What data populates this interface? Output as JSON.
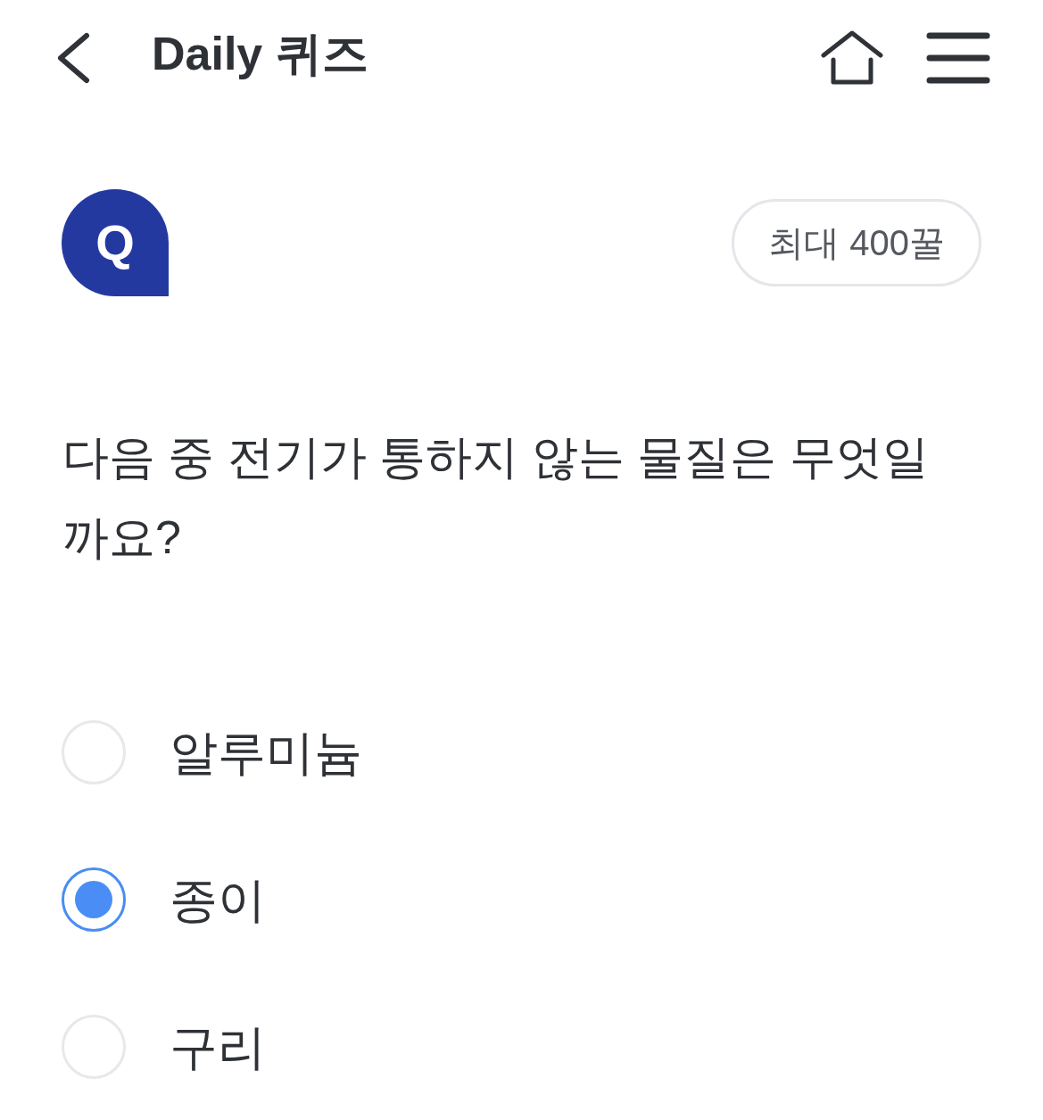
{
  "header": {
    "title": "Daily 퀴즈"
  },
  "quiz": {
    "bubble_letter": "Q",
    "reward_badge": "최대 400꿀",
    "question": "다음 중 전기가 통하지 않는 물질은 무엇일까요?"
  },
  "options": [
    {
      "label": "알루미늄",
      "selected": false
    },
    {
      "label": "종이",
      "selected": true
    },
    {
      "label": "구리",
      "selected": false
    }
  ]
}
